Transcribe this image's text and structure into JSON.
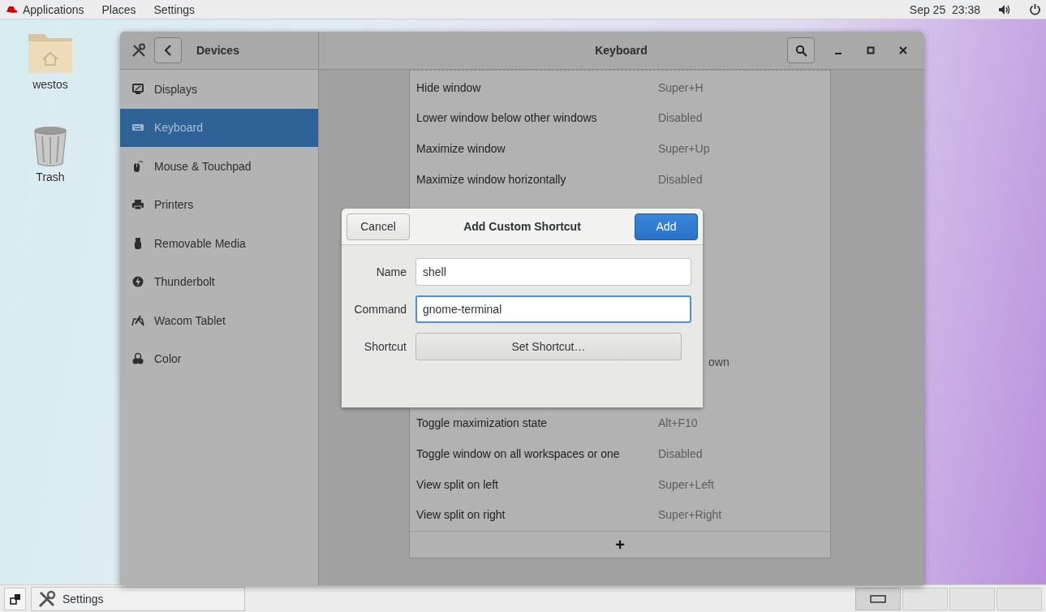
{
  "top_bar": {
    "menus": [
      "Applications",
      "Places",
      "Settings"
    ],
    "clock": "Sep 25  23:38"
  },
  "desktop_icons": [
    {
      "label": "westos",
      "kind": "home-folder"
    },
    {
      "label": "Trash",
      "kind": "trash"
    }
  ],
  "window": {
    "sidebar_title": "Devices",
    "title": "Keyboard",
    "sidebar_items": [
      {
        "label": "Displays",
        "kind": "display",
        "selected": false
      },
      {
        "label": "Keyboard",
        "kind": "keyboard",
        "selected": true
      },
      {
        "label": "Mouse & Touchpad",
        "kind": "mouse",
        "selected": false
      },
      {
        "label": "Printers",
        "kind": "printer",
        "selected": false
      },
      {
        "label": "Removable Media",
        "kind": "usb",
        "selected": false
      },
      {
        "label": "Thunderbolt",
        "kind": "bolt",
        "selected": false
      },
      {
        "label": "Wacom Tablet",
        "kind": "tablet",
        "selected": false
      },
      {
        "label": "Color",
        "kind": "color",
        "selected": false
      }
    ],
    "shortcuts": {
      "rows_above": [
        {
          "name": "Hide window",
          "shortcut": "Super+H"
        },
        {
          "name": "Lower window below other windows",
          "shortcut": "Disabled"
        },
        {
          "name": "Maximize window",
          "shortcut": "Super+Up"
        },
        {
          "name": "Maximize window horizontally",
          "shortcut": "Disabled"
        }
      ],
      "partial_shortcut": "own",
      "rows_below": [
        {
          "name": "Toggle maximization state",
          "shortcut": "Alt+F10"
        },
        {
          "name": "Toggle window on all workspaces or one",
          "shortcut": "Disabled"
        },
        {
          "name": "View split on left",
          "shortcut": "Super+Left"
        },
        {
          "name": "View split on right",
          "shortcut": "Super+Right"
        }
      ],
      "add_label": "+"
    }
  },
  "dialog": {
    "title": "Add Custom Shortcut",
    "cancel": "Cancel",
    "confirm": "Add",
    "fields": [
      {
        "label": "Name",
        "value": "shell",
        "focused": false
      },
      {
        "label": "Command",
        "value": "gnome-terminal",
        "focused": true
      }
    ],
    "shortcut_label": "Shortcut",
    "shortcut_button": "Set Shortcut…"
  },
  "taskbar": {
    "task": "Settings",
    "workspaces": [
      {
        "selected": true
      },
      {
        "selected": false
      },
      {
        "selected": false
      },
      {
        "selected": false
      }
    ]
  }
}
